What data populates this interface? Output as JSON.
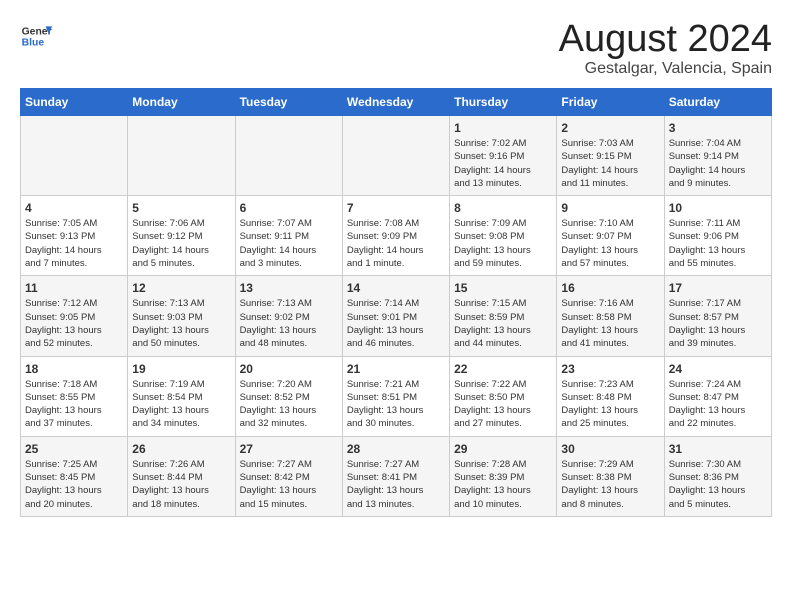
{
  "header": {
    "logo_line1": "General",
    "logo_line2": "Blue",
    "month_year": "August 2024",
    "location": "Gestalgar, Valencia, Spain"
  },
  "days_of_week": [
    "Sunday",
    "Monday",
    "Tuesday",
    "Wednesday",
    "Thursday",
    "Friday",
    "Saturday"
  ],
  "weeks": [
    [
      {
        "day": "",
        "info": ""
      },
      {
        "day": "",
        "info": ""
      },
      {
        "day": "",
        "info": ""
      },
      {
        "day": "",
        "info": ""
      },
      {
        "day": "1",
        "info": "Sunrise: 7:02 AM\nSunset: 9:16 PM\nDaylight: 14 hours\nand 13 minutes."
      },
      {
        "day": "2",
        "info": "Sunrise: 7:03 AM\nSunset: 9:15 PM\nDaylight: 14 hours\nand 11 minutes."
      },
      {
        "day": "3",
        "info": "Sunrise: 7:04 AM\nSunset: 9:14 PM\nDaylight: 14 hours\nand 9 minutes."
      }
    ],
    [
      {
        "day": "4",
        "info": "Sunrise: 7:05 AM\nSunset: 9:13 PM\nDaylight: 14 hours\nand 7 minutes."
      },
      {
        "day": "5",
        "info": "Sunrise: 7:06 AM\nSunset: 9:12 PM\nDaylight: 14 hours\nand 5 minutes."
      },
      {
        "day": "6",
        "info": "Sunrise: 7:07 AM\nSunset: 9:11 PM\nDaylight: 14 hours\nand 3 minutes."
      },
      {
        "day": "7",
        "info": "Sunrise: 7:08 AM\nSunset: 9:09 PM\nDaylight: 14 hours\nand 1 minute."
      },
      {
        "day": "8",
        "info": "Sunrise: 7:09 AM\nSunset: 9:08 PM\nDaylight: 13 hours\nand 59 minutes."
      },
      {
        "day": "9",
        "info": "Sunrise: 7:10 AM\nSunset: 9:07 PM\nDaylight: 13 hours\nand 57 minutes."
      },
      {
        "day": "10",
        "info": "Sunrise: 7:11 AM\nSunset: 9:06 PM\nDaylight: 13 hours\nand 55 minutes."
      }
    ],
    [
      {
        "day": "11",
        "info": "Sunrise: 7:12 AM\nSunset: 9:05 PM\nDaylight: 13 hours\nand 52 minutes."
      },
      {
        "day": "12",
        "info": "Sunrise: 7:13 AM\nSunset: 9:03 PM\nDaylight: 13 hours\nand 50 minutes."
      },
      {
        "day": "13",
        "info": "Sunrise: 7:13 AM\nSunset: 9:02 PM\nDaylight: 13 hours\nand 48 minutes."
      },
      {
        "day": "14",
        "info": "Sunrise: 7:14 AM\nSunset: 9:01 PM\nDaylight: 13 hours\nand 46 minutes."
      },
      {
        "day": "15",
        "info": "Sunrise: 7:15 AM\nSunset: 8:59 PM\nDaylight: 13 hours\nand 44 minutes."
      },
      {
        "day": "16",
        "info": "Sunrise: 7:16 AM\nSunset: 8:58 PM\nDaylight: 13 hours\nand 41 minutes."
      },
      {
        "day": "17",
        "info": "Sunrise: 7:17 AM\nSunset: 8:57 PM\nDaylight: 13 hours\nand 39 minutes."
      }
    ],
    [
      {
        "day": "18",
        "info": "Sunrise: 7:18 AM\nSunset: 8:55 PM\nDaylight: 13 hours\nand 37 minutes."
      },
      {
        "day": "19",
        "info": "Sunrise: 7:19 AM\nSunset: 8:54 PM\nDaylight: 13 hours\nand 34 minutes."
      },
      {
        "day": "20",
        "info": "Sunrise: 7:20 AM\nSunset: 8:52 PM\nDaylight: 13 hours\nand 32 minutes."
      },
      {
        "day": "21",
        "info": "Sunrise: 7:21 AM\nSunset: 8:51 PM\nDaylight: 13 hours\nand 30 minutes."
      },
      {
        "day": "22",
        "info": "Sunrise: 7:22 AM\nSunset: 8:50 PM\nDaylight: 13 hours\nand 27 minutes."
      },
      {
        "day": "23",
        "info": "Sunrise: 7:23 AM\nSunset: 8:48 PM\nDaylight: 13 hours\nand 25 minutes."
      },
      {
        "day": "24",
        "info": "Sunrise: 7:24 AM\nSunset: 8:47 PM\nDaylight: 13 hours\nand 22 minutes."
      }
    ],
    [
      {
        "day": "25",
        "info": "Sunrise: 7:25 AM\nSunset: 8:45 PM\nDaylight: 13 hours\nand 20 minutes."
      },
      {
        "day": "26",
        "info": "Sunrise: 7:26 AM\nSunset: 8:44 PM\nDaylight: 13 hours\nand 18 minutes."
      },
      {
        "day": "27",
        "info": "Sunrise: 7:27 AM\nSunset: 8:42 PM\nDaylight: 13 hours\nand 15 minutes."
      },
      {
        "day": "28",
        "info": "Sunrise: 7:27 AM\nSunset: 8:41 PM\nDaylight: 13 hours\nand 13 minutes."
      },
      {
        "day": "29",
        "info": "Sunrise: 7:28 AM\nSunset: 8:39 PM\nDaylight: 13 hours\nand 10 minutes."
      },
      {
        "day": "30",
        "info": "Sunrise: 7:29 AM\nSunset: 8:38 PM\nDaylight: 13 hours\nand 8 minutes."
      },
      {
        "day": "31",
        "info": "Sunrise: 7:30 AM\nSunset: 8:36 PM\nDaylight: 13 hours\nand 5 minutes."
      }
    ]
  ]
}
